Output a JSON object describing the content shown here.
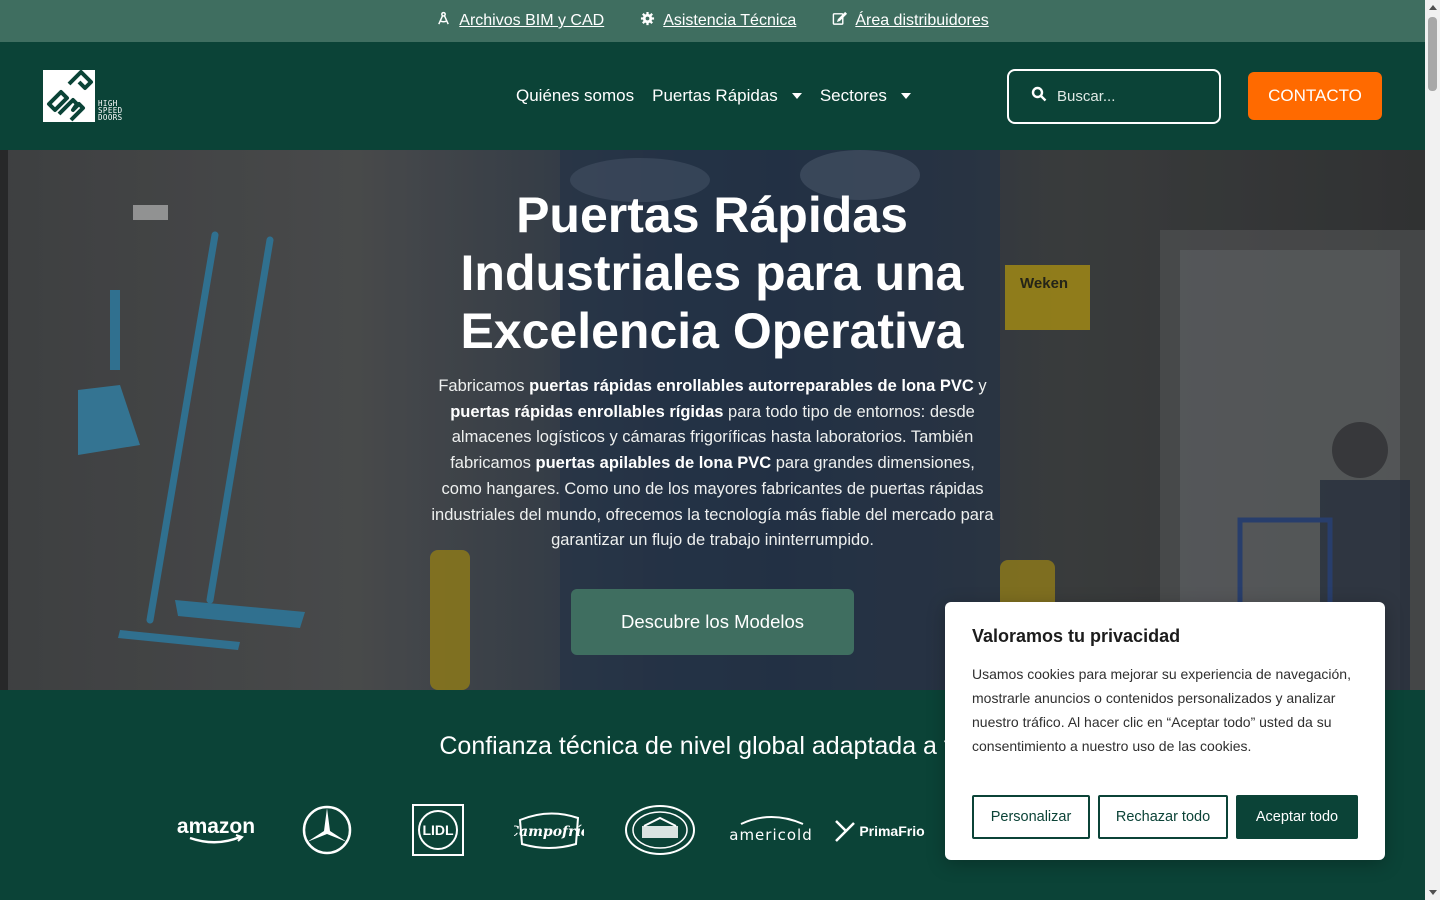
{
  "topbar": {
    "links": [
      {
        "label": "Archivos BIM y CAD",
        "icon": "drafting-compass-icon"
      },
      {
        "label": "Asistencia Técnica",
        "icon": "gear-icon"
      },
      {
        "label": "Área distribuidores",
        "icon": "edit-icon"
      }
    ]
  },
  "header": {
    "logo_text": "BMP",
    "logo_words": [
      "HIGH",
      "SPEED",
      "DOORS"
    ],
    "nav": [
      {
        "label": "Quiénes somos",
        "has_dropdown": false
      },
      {
        "label": "Puertas Rápidas",
        "has_dropdown": true
      },
      {
        "label": "Sectores",
        "has_dropdown": true
      }
    ],
    "search_placeholder": "Buscar...",
    "contact_label": "CONTACTO"
  },
  "hero": {
    "title": "Puertas Rápidas Industriales para una Excelencia Operativa",
    "description": [
      {
        "text": "Fabricamos ",
        "bold": false
      },
      {
        "text": "puertas rápidas enrollables autorreparables de lona PVC",
        "bold": true
      },
      {
        "text": " y ",
        "bold": false
      },
      {
        "text": "puertas rápidas enrollables rígidas",
        "bold": true
      },
      {
        "text": " para todo tipo de entornos: desde almacenes logísticos y cámaras frigoríficas hasta laboratorios. También fabricamos ",
        "bold": false
      },
      {
        "text": "puertas apilables de lona PVC",
        "bold": true
      },
      {
        "text": " para grandes dimensiones, como hangares. Como uno de los mayores fabricantes de puertas rápidas industriales del mundo, ofrecemos la tecnología más fiable del mercado para garantizar un flujo de trabajo ininterrumpido.",
        "bold": false
      }
    ],
    "button_label": "Descubre los Modelos"
  },
  "trust": {
    "title": "Confianza técnica de nivel global adaptada a tu n",
    "brands": [
      "amazon",
      "Mercedes-Benz",
      "LIDL",
      "Campofrío",
      "Casa Tarradellas",
      "americold",
      "PrimaFrio"
    ]
  },
  "cookie": {
    "title": "Valoramos tu privacidad",
    "text": "Usamos cookies para mejorar su experiencia de navegación, mostrarle anuncios o contenidos personalizados y analizar nuestro tráfico. Al hacer clic en “Aceptar todo” usted da su consentimiento a nuestro uso de las cookies.",
    "buttons": {
      "customize": "Personalizar",
      "reject": "Rechazar todo",
      "accept": "Aceptar todo"
    }
  },
  "colors": {
    "brand_green": "#0b4337",
    "topbar_green": "#3f6e60",
    "accent_orange": "#ff6a00"
  }
}
